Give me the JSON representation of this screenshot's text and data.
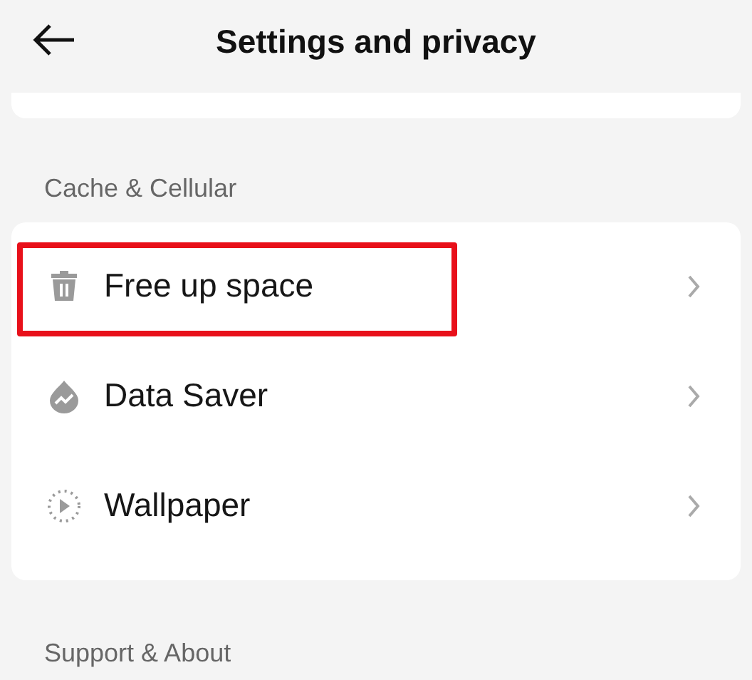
{
  "header": {
    "title": "Settings and privacy"
  },
  "sections": [
    {
      "title": "Cache & Cellular",
      "items": [
        {
          "label": "Free up space",
          "kind": "trash",
          "highlighted": true
        },
        {
          "label": "Data Saver",
          "kind": "data-saver",
          "highlighted": false
        },
        {
          "label": "Wallpaper",
          "kind": "wallpaper",
          "highlighted": false
        }
      ]
    },
    {
      "title": "Support & About"
    }
  ]
}
